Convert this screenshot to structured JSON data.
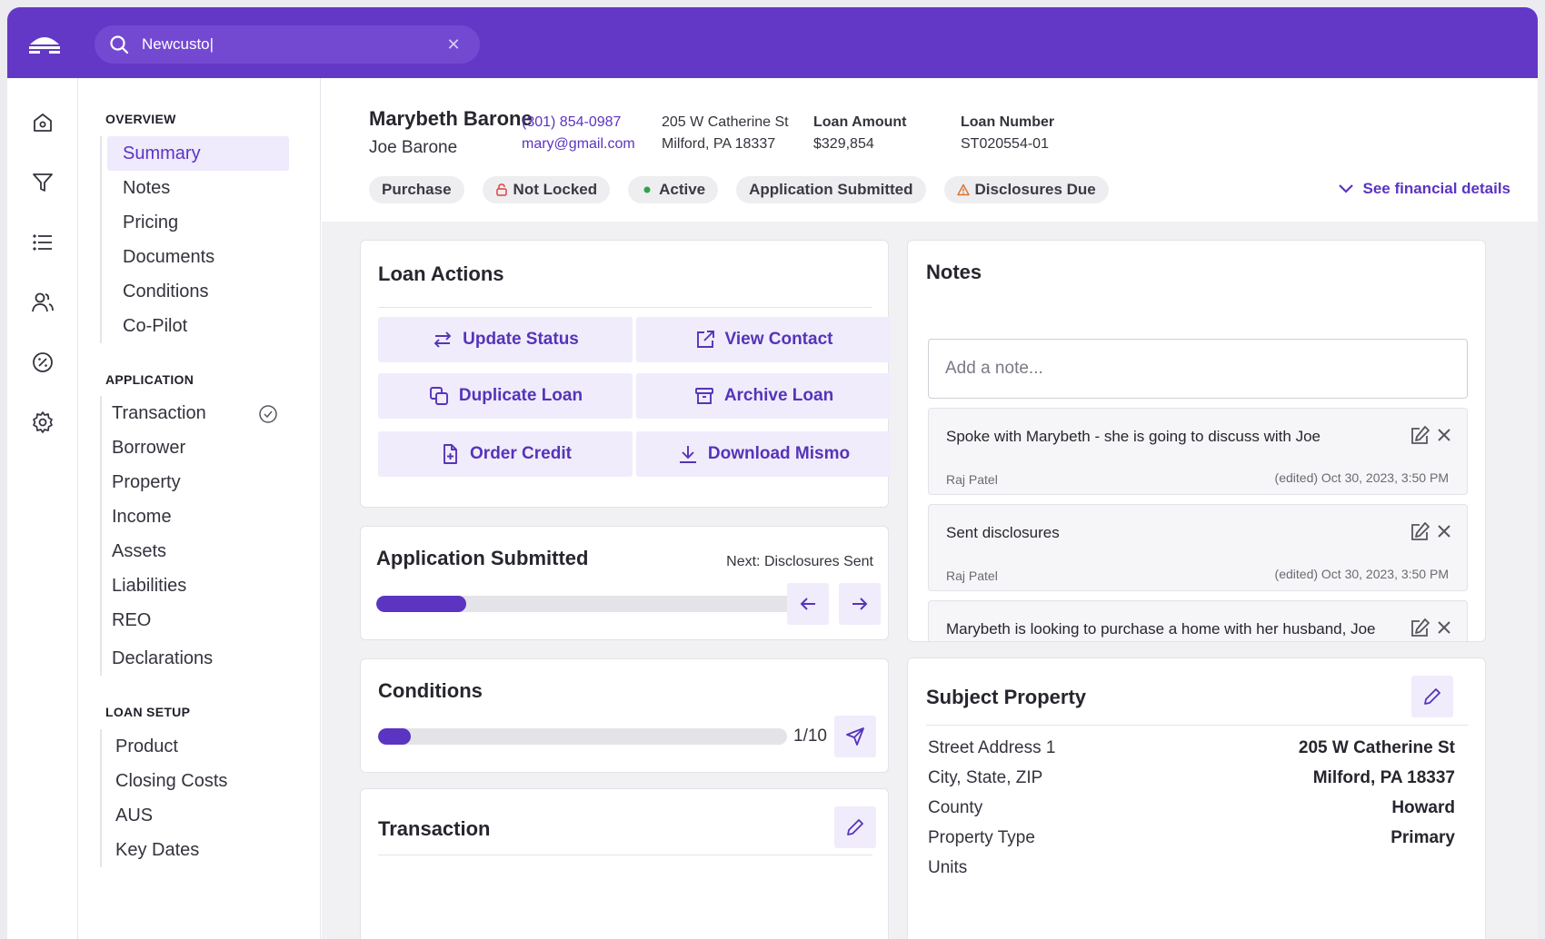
{
  "search": {
    "value": "Newcusto|"
  },
  "sidebar": {
    "overview_title": "OVERVIEW",
    "overview": [
      "Summary",
      "Notes",
      "Pricing",
      "Documents",
      "Conditions",
      "Co-Pilot"
    ],
    "application_title": "APPLICATION",
    "application": [
      "Transaction",
      "Borrower",
      "Property",
      "Income",
      "Assets",
      "Liabilities",
      "REO",
      "Declarations"
    ],
    "loan_setup_title": "LOAN SETUP",
    "loan_setup": [
      "Product",
      "Closing Costs",
      "AUS",
      "Key Dates"
    ]
  },
  "header": {
    "borrower": "Marybeth Barone",
    "co_borrower": "Joe Barone",
    "phone": "(301) 854-0987",
    "email": "mary@gmail.com",
    "address_line1": "205 W Catherine St",
    "address_line2": "Milford, PA 18337",
    "loan_amount_label": "Loan Amount",
    "loan_amount": "$329,854",
    "loan_number_label": "Loan Number",
    "loan_number": "ST020554-01",
    "chips": {
      "purchase": "Purchase",
      "lock": "Not Locked",
      "status": "Active",
      "stage": "Application Submitted",
      "disclosures": "Disclosures Due"
    },
    "financial_link": "See financial details"
  },
  "loan_actions": {
    "title": "Loan Actions",
    "update_status": "Update Status",
    "view_contact": "View Contact",
    "duplicate_loan": "Duplicate Loan",
    "archive_loan": "Archive Loan",
    "order_credit": "Order Credit",
    "download_mismo": "Download Mismo"
  },
  "progress": {
    "title": "Application Submitted",
    "next": "Next: Disclosures Sent",
    "fraction": 0.21
  },
  "conditions": {
    "title": "Conditions",
    "count": "1/10",
    "fraction": 0.08
  },
  "transaction": {
    "title": "Transaction"
  },
  "notes": {
    "title": "Notes",
    "placeholder": "Add a note...",
    "items": [
      {
        "text": "Spoke with Marybeth - she is going to discuss with Joe",
        "author": "Raj Patel",
        "date": "(edited) Oct 30, 2023, 3:50 PM"
      },
      {
        "text": "Sent disclosures",
        "author": "Raj Patel",
        "date": "(edited) Oct 30, 2023, 3:50 PM"
      },
      {
        "text": "Marybeth is looking to purchase a home with her husband, Joe",
        "author": "",
        "date": ""
      }
    ]
  },
  "subject_property": {
    "title": "Subject Property",
    "rows": [
      {
        "label": "Street Address 1",
        "value": "205 W Catherine St"
      },
      {
        "label": "City, State, ZIP",
        "value": "Milford, PA 18337"
      },
      {
        "label": "County",
        "value": "Howard"
      },
      {
        "label": "Property Type",
        "value": "Primary"
      },
      {
        "label": "Units",
        "value": ""
      }
    ]
  },
  "colors": {
    "brand": "#6338c7",
    "accent": "#5b34c2",
    "accent_soft": "#f0ecfc"
  }
}
